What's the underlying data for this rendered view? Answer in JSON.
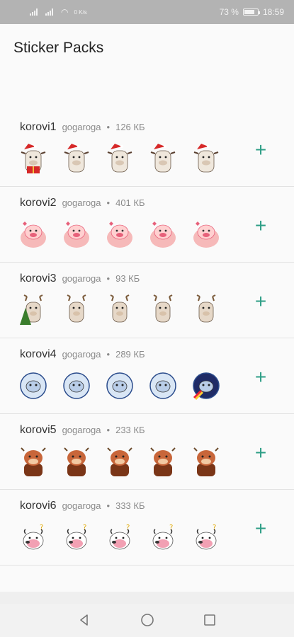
{
  "status": {
    "battery": "73 %",
    "time": "18:59",
    "speed": "0 K/s"
  },
  "header": {
    "title": "Sticker Packs"
  },
  "packs": [
    {
      "name": "korovi1",
      "author": "gogaroga",
      "size": "126 КБ",
      "theme": "christmas-cow"
    },
    {
      "name": "korovi2",
      "author": "gogaroga",
      "size": "401 КБ",
      "theme": "pink-cow"
    },
    {
      "name": "korovi3",
      "author": "gogaroga",
      "size": "93 КБ",
      "theme": "deer-cow"
    },
    {
      "name": "korovi4",
      "author": "gogaroga",
      "size": "289 КБ",
      "theme": "space-cow"
    },
    {
      "name": "korovi5",
      "author": "gogaroga",
      "size": "233 КБ",
      "theme": "brown-cow"
    },
    {
      "name": "korovi6",
      "author": "gogaroga",
      "size": "333 КБ",
      "theme": "white-cow"
    }
  ],
  "icons": {
    "add": "plus-icon",
    "back": "back-triangle-icon",
    "home": "home-circle-icon",
    "recents": "recents-square-icon"
  },
  "colors": {
    "accent": "#2e9e86",
    "status_bar": "#b3b3b3"
  }
}
